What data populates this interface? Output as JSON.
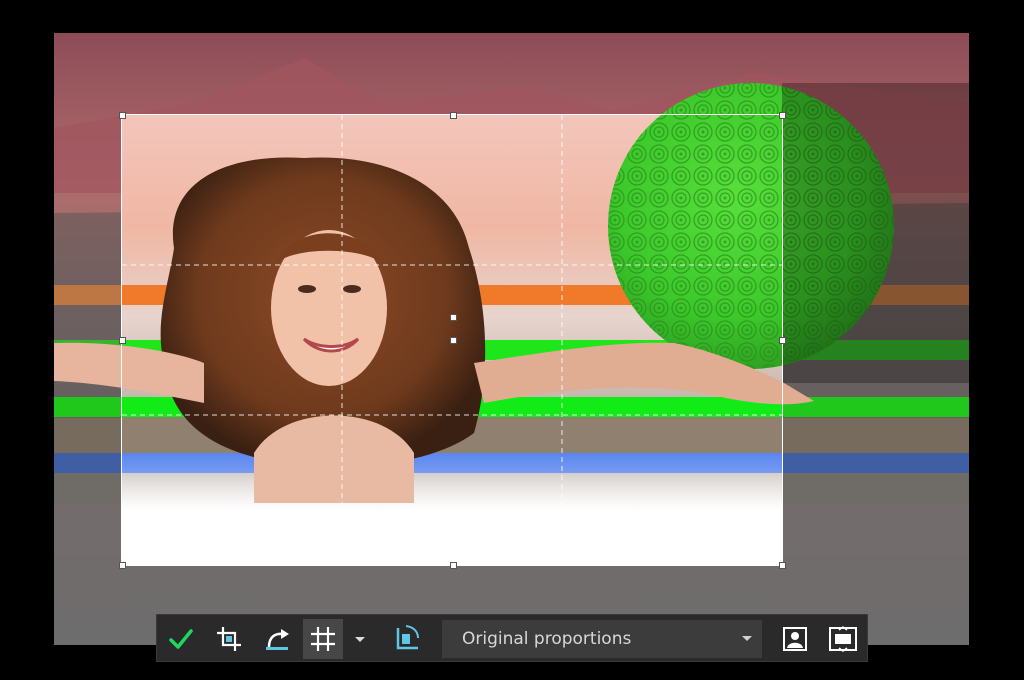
{
  "canvas": {
    "subject": "woman-with-curly-hair-photo",
    "icons": {
      "mountains": "mountain-backdrop",
      "sphere": "green-textured-sphere"
    },
    "colors": {
      "sky_top": "#a8585e",
      "sky_mid": "#c58b7e",
      "sphere": "#3fcf2a",
      "stripe_orange": "#f07a2a",
      "stripe_green": "#1ee61b",
      "stripe_blue": "#3d6ee6"
    }
  },
  "crop": {
    "grid": "rule-of-thirds",
    "handle_color": "#ffffff"
  },
  "toolbar": {
    "apply_icon": "check-icon",
    "crop_icon": "crop-frame-icon",
    "undo_icon": "undo-arrow-icon",
    "grid_icon": "grid-icon",
    "grid_menu_icon": "triangle-down-icon",
    "rotate_icon": "rotate-straighten-icon",
    "proportions_value": "Original proportions",
    "portrait_icon": "portrait-icon",
    "fit_icon": "fit-screen-icon",
    "accent": "#1ed760"
  }
}
